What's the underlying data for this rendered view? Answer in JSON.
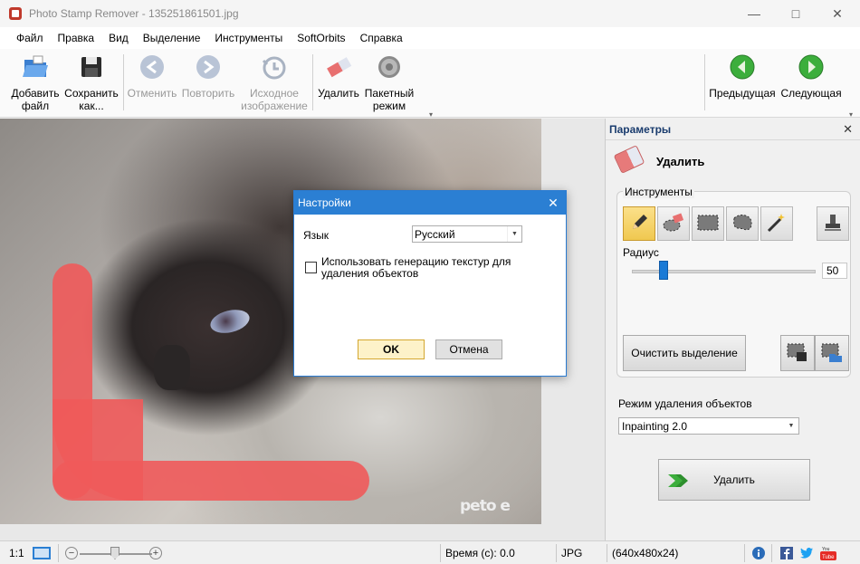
{
  "window": {
    "title": "Photo Stamp Remover - 135251861501.jpg"
  },
  "menu": [
    "Файл",
    "Правка",
    "Вид",
    "Выделение",
    "Инструменты",
    "SoftOrbits",
    "Справка"
  ],
  "toolbar": {
    "add_file": [
      "Добавить",
      "файл"
    ],
    "save_as": [
      "Сохранить",
      "как..."
    ],
    "undo": "Отменить",
    "redo": "Повторить",
    "original": [
      "Исходное",
      "изображение"
    ],
    "remove": "Удалить",
    "batch": [
      "Пакетный",
      "режим"
    ],
    "prev": "Предыдущая",
    "next": "Следующая"
  },
  "image": {
    "watermark": "peto e"
  },
  "dialog": {
    "title": "Настройки",
    "language_label": "Язык",
    "language_value": "Русский",
    "checkbox_label": "Использовать генерацию текстур для удаления объектов",
    "checkbox_checked": false,
    "ok": "OK",
    "cancel": "Отмена"
  },
  "panel": {
    "header": "Параметры",
    "section": "Удалить",
    "tools_group": "Инструменты",
    "radius_label": "Радиус",
    "radius_value": "50",
    "radius_fraction": 0.17,
    "clear_selection": "Очистить выделение",
    "mode_label": "Режим удаления объектов",
    "mode_value": "Inpainting 2.0",
    "remove_button": "Удалить"
  },
  "status": {
    "zoom_label": "1:1",
    "time": "Время (с): 0.0",
    "format": "JPG",
    "dimensions": "(640x480x24)"
  },
  "colors": {
    "accent": "#2b7fd3",
    "selection_stroke": "#f05a5a",
    "nav_green": "#3cae3c"
  }
}
